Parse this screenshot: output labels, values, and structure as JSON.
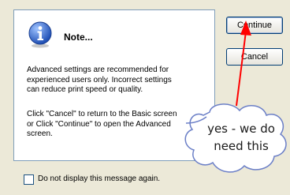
{
  "dialog": {
    "title": "Note...",
    "message_1": "Advanced settings are recommended for\nexperienced users only. Incorrect settings\ncan reduce print speed or quality.",
    "message_2": "Click \"Cancel\" to return to the Basic screen\nor Click \"Continue\" to open the Advanced\nscreen.",
    "icon": "info-icon"
  },
  "buttons": {
    "continue_label": "Continue",
    "cancel_label": "Cancel"
  },
  "checkbox": {
    "label": "Do not display this message again.",
    "checked": false
  },
  "annotation": {
    "text": "yes - we do\nneed this",
    "arrow_color": "#ff0000",
    "cloud_border_color": "#6b7fc7"
  }
}
